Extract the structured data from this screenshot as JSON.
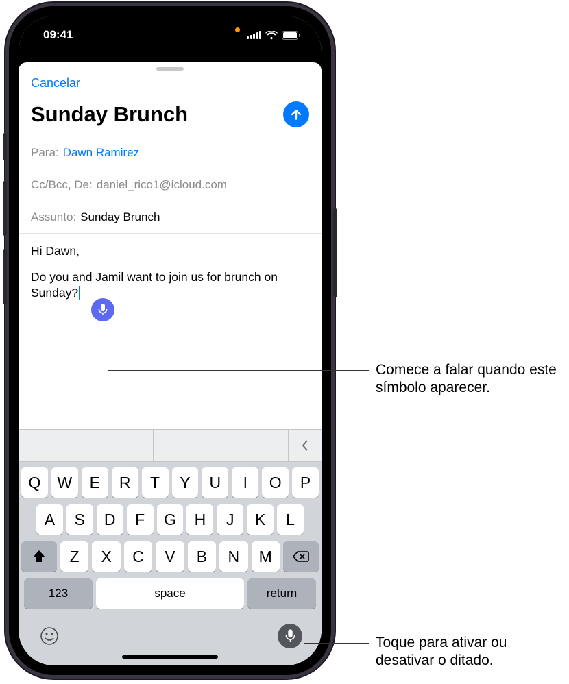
{
  "statusbar": {
    "time": "09:41"
  },
  "compose": {
    "cancel": "Cancelar",
    "title": "Sunday Brunch",
    "to_label": "Para:",
    "to_value": "Dawn Ramirez",
    "ccbcc_label": "Cc/Bcc, De:",
    "ccbcc_value": "daniel_rico1@icloud.com",
    "subject_label": "Assunto:",
    "subject_value": "Sunday Brunch",
    "body_greeting": "Hi Dawn,",
    "body_text": "Do you and Jamil want to join us for brunch on Sunday?"
  },
  "keyboard": {
    "row1": [
      "Q",
      "W",
      "E",
      "R",
      "T",
      "Y",
      "U",
      "I",
      "O",
      "P"
    ],
    "row2": [
      "A",
      "S",
      "D",
      "F",
      "G",
      "H",
      "J",
      "K",
      "L"
    ],
    "row3": [
      "Z",
      "X",
      "C",
      "V",
      "B",
      "N",
      "M"
    ],
    "key_123": "123",
    "key_space": "space",
    "key_return": "return"
  },
  "callouts": {
    "dictation_bubble": "Comece a falar quando este símbolo aparecer.",
    "mic_toggle": "Toque para ativar ou desativar o ditado."
  }
}
